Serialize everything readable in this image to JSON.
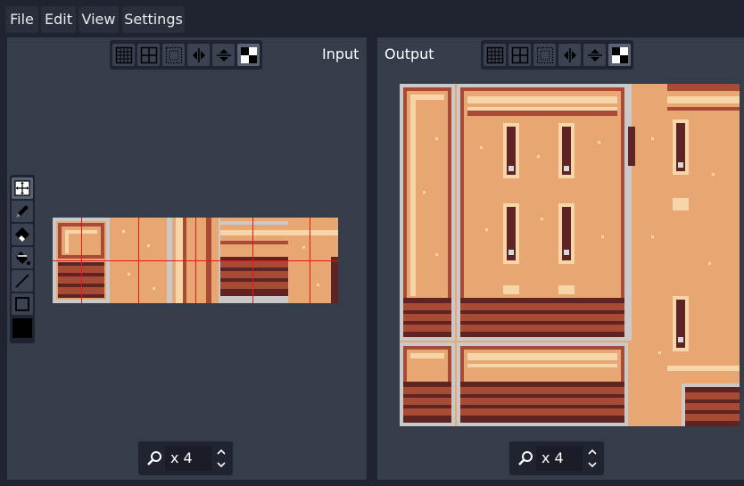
{
  "menu": [
    {
      "label": "File"
    },
    {
      "label": "Edit"
    },
    {
      "label": "View"
    },
    {
      "label": "Settings"
    }
  ],
  "input_panel": {
    "title": "Input",
    "toolbar_icons": [
      "grid-icon",
      "grid-large-icon",
      "dotted-grid-icon",
      "flip-horizontal-icon",
      "flip-vertical-icon",
      "checker-icon"
    ],
    "tools": [
      "select-tool-icon",
      "pencil-icon",
      "eraser-icon",
      "bucket-fill-icon",
      "line-tool-icon",
      "rectangle-tool-icon"
    ],
    "active_color": "#000000",
    "zoom": {
      "value": "x 4"
    }
  },
  "output_panel": {
    "title": "Output",
    "toolbar_icons": [
      "grid-icon",
      "grid-large-icon",
      "dotted-grid-icon",
      "flip-horizontal-icon",
      "flip-vertical-icon",
      "checker-icon"
    ],
    "zoom": {
      "value": "x 4"
    }
  },
  "colors": {
    "background": "#202431",
    "panel": "#363d4a",
    "sand": "#e8a673",
    "brick": "#a84b35",
    "dark_brick": "#5e2323",
    "light": "#f6d6a8",
    "grid_line": "#e01818"
  }
}
